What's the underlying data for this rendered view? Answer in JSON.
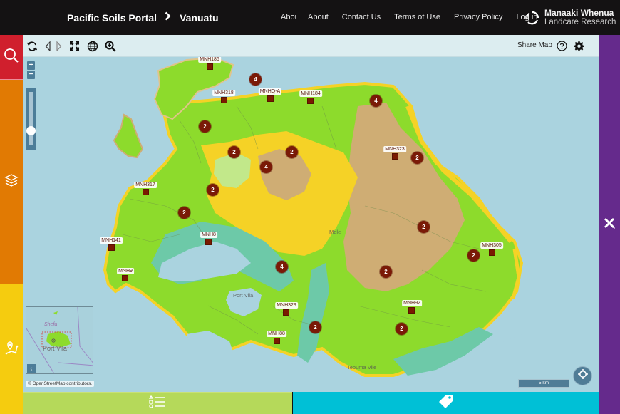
{
  "header": {
    "breadcrumb": {
      "portal": "Pacific Soils Portal",
      "separator": ">",
      "region": "Vanuatu"
    },
    "nav": [
      {
        "label": "About",
        "truncated": true
      },
      {
        "label": "About"
      },
      {
        "label": "Contact Us"
      },
      {
        "label": "Terms of Use"
      },
      {
        "label": "Privacy Policy"
      },
      {
        "label": "Log in"
      }
    ],
    "brand": {
      "line1": "Manaaki Whenua",
      "line2": "Landcare Research",
      "icon": "circle-arrows-logo"
    }
  },
  "left_rail": [
    {
      "name": "search",
      "icon": "search-icon",
      "color": "#d01f2d"
    },
    {
      "name": "layers",
      "icon": "layers-icon",
      "color": "#e17a03"
    },
    {
      "name": "route",
      "icon": "map-route-pin-icon",
      "color": "#f5cc0f"
    }
  ],
  "right_rail": {
    "icon": "ruler-pencil-icon",
    "color": "#652a8c"
  },
  "toolbar": {
    "tools": [
      "refresh-icon",
      "back-icon",
      "forward-icon",
      "fullscreen-icon",
      "globe-icon",
      "zoom-in-icon"
    ],
    "share_label": "Share Map",
    "help_icon": "question-icon",
    "settings_icon": "gear-icon"
  },
  "zoom": {
    "in_label": "+",
    "out_label": "−",
    "slider_level": 0.22
  },
  "sites": [
    {
      "label": "MNH186"
    },
    {
      "label": "MNH318"
    },
    {
      "label": "MNHQ-A"
    },
    {
      "label": "MNH184"
    },
    {
      "label": "MNH323"
    },
    {
      "label": "MNH317"
    },
    {
      "label": "MNH141"
    },
    {
      "label": "MNH8"
    },
    {
      "label": "MNH9"
    },
    {
      "label": "MNH305"
    },
    {
      "label": "MNH329"
    },
    {
      "label": "MNH92"
    },
    {
      "label": "MNH88"
    }
  ],
  "clusters": [
    {
      "count": "4"
    },
    {
      "count": "4"
    },
    {
      "count": "2"
    },
    {
      "count": "2"
    },
    {
      "count": "2"
    },
    {
      "count": "4"
    },
    {
      "count": "2"
    },
    {
      "count": "2"
    },
    {
      "count": "2"
    },
    {
      "count": "2"
    },
    {
      "count": "2"
    },
    {
      "count": "4"
    },
    {
      "count": "2"
    },
    {
      "count": "2"
    },
    {
      "count": "2"
    }
  ],
  "places": [
    "Port Vila",
    "Mele",
    "Teouma Vile"
  ],
  "overview": {
    "labels": [
      "Shefa",
      "Port Vila"
    ],
    "toggle": "‹"
  },
  "attribution": "© OpenStreetMap contributors.",
  "scale": "5 km",
  "bottom": {
    "left_icon": "legend-list-icon",
    "right_icon": "tag-icon",
    "left_color": "#b5d95a",
    "right_color": "#00c0d6"
  },
  "soil_colors": {
    "green": "#8ddb2c",
    "light_green": "#c2e88a",
    "yellow": "#f5d226",
    "tan": "#cfad74",
    "teal": "#6dc9a8",
    "sea": "#aad3df"
  }
}
